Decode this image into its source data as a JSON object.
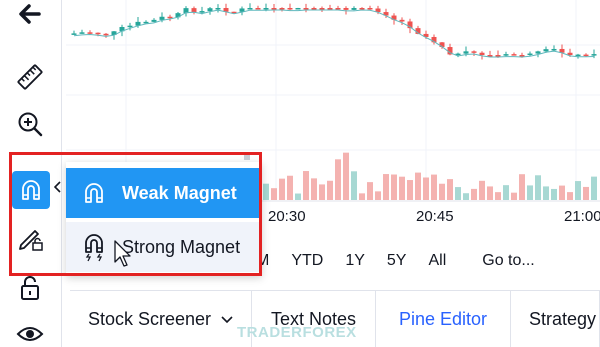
{
  "toolbar": {
    "items": [
      {
        "name": "back-arrow-icon"
      },
      {
        "name": "ruler-icon"
      },
      {
        "name": "zoom-in-icon"
      },
      {
        "name": "magnet-icon",
        "active": true
      },
      {
        "name": "pencil-lock-icon"
      },
      {
        "name": "lock-icon"
      },
      {
        "name": "eye-icon"
      }
    ]
  },
  "magnet_menu": {
    "items": [
      {
        "label": "Weak Magnet",
        "selected": true,
        "icon": "magnet-icon"
      },
      {
        "label": "Strong Magnet",
        "selected": false,
        "icon": "strong-magnet-icon"
      }
    ]
  },
  "time_axis": {
    "labels": [
      "20:30",
      "20:45",
      "21:00"
    ]
  },
  "date_range": {
    "items": [
      "M",
      "YTD",
      "1Y",
      "5Y",
      "All"
    ],
    "goto": "Go to..."
  },
  "bottom_tabs": [
    {
      "label": "Stock Screener",
      "has_dropdown": true,
      "active": false
    },
    {
      "label": "Text Notes",
      "active": false
    },
    {
      "label": "Pine Editor",
      "active": true
    },
    {
      "label": "Strategy",
      "active": false
    }
  ],
  "watermark": {
    "text": "TRADERFOREX"
  },
  "colors": {
    "accent": "#2196f3",
    "up_candle": "#26a69a",
    "down_candle": "#ef5350",
    "highlight": "#e32222",
    "tab_active": "#2962ff"
  }
}
